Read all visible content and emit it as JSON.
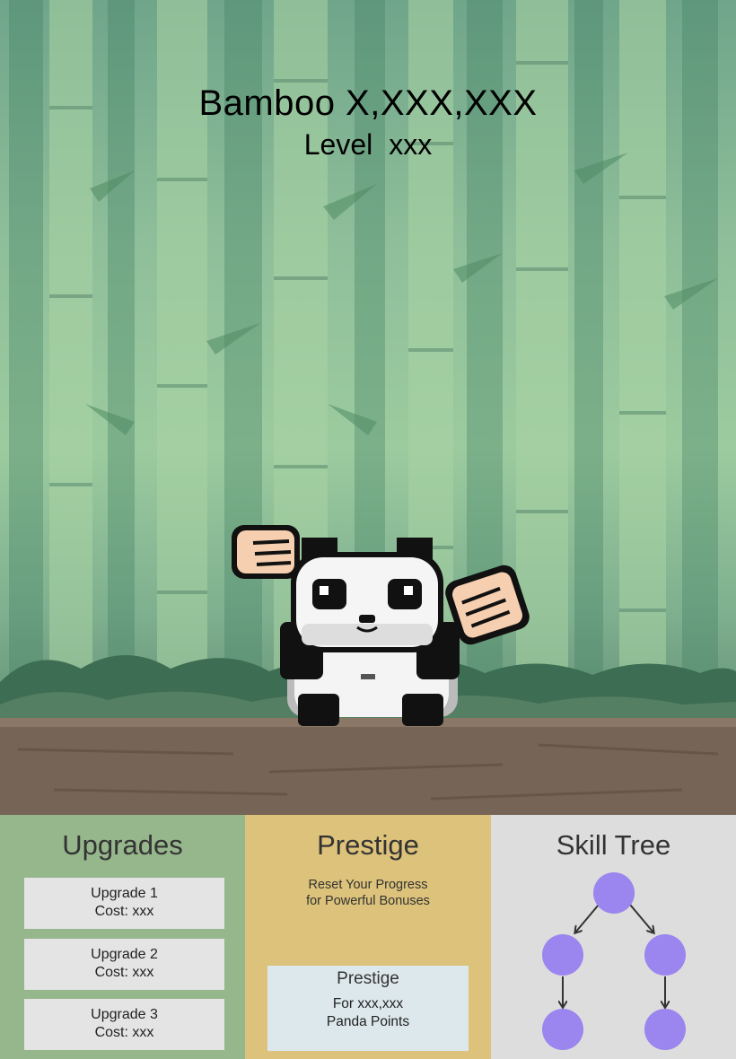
{
  "hud": {
    "bamboo_label": "Bamboo X,XXX,XXX",
    "level_label": "Level",
    "level_value": "xxx"
  },
  "colors": {
    "upgrades_panel": "#96b68c",
    "prestige_panel": "#dcc27a",
    "skill_panel": "#dddddd",
    "skill_node": "#9b85ee"
  },
  "upgrades": {
    "title": "Upgrades",
    "items": [
      {
        "name": "Upgrade 1",
        "cost": "Cost: xxx"
      },
      {
        "name": "Upgrade 2",
        "cost": "Cost: xxx"
      },
      {
        "name": "Upgrade 3",
        "cost": "Cost: xxx"
      }
    ]
  },
  "prestige": {
    "title": "Prestige",
    "description_line1": "Reset Your Progress",
    "description_line2": "for Powerful Bonuses",
    "button_label": "Prestige",
    "reward_line1": "For xxx,xxx",
    "reward_line2": "Panda Points"
  },
  "skill_tree": {
    "title": "Skill Tree"
  }
}
